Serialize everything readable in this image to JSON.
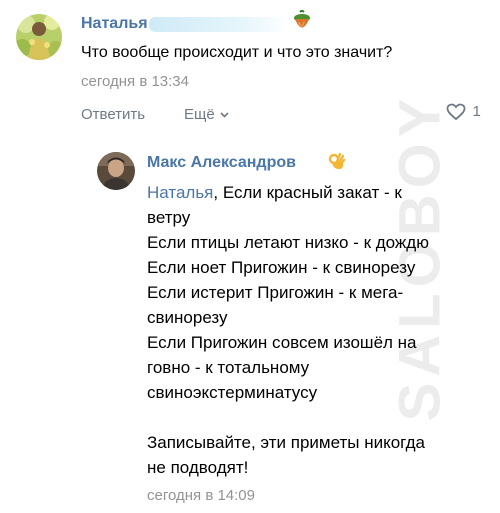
{
  "watermark": "SALOBOY",
  "comment": {
    "author": "Наталья",
    "text": "Что вообще происходит и что это значит?",
    "time": "сегодня в 13:34",
    "reply_label": "Ответить",
    "more_label": "Ещё",
    "likes": "1"
  },
  "reply": {
    "author": "Макс Александров",
    "mention": "Наталья",
    "lines": [
      ", Если красный закат - к",
      "ветру",
      "Если птицы летают низко - к дождю",
      "Если ноет Пригожин - к свинорезу",
      "Если истерит Пригожин - к мега-",
      "свинорезу",
      "Если Пригожин совсем изошёл на",
      "говно - к тотальному",
      "свиноэкстерминатусу",
      "",
      "Записывайте, эти приметы никогда",
      "не подводят!"
    ],
    "time": "сегодня в 14:09"
  },
  "colors": {
    "link": "#4a76a8",
    "meta": "#939393",
    "action": "#6f7985",
    "heart": "#6f7985"
  },
  "icons": [
    "profile-avatar",
    "acorn-emoji",
    "chevron-down-icon",
    "heart-icon",
    "ok-hand-emoji"
  ]
}
